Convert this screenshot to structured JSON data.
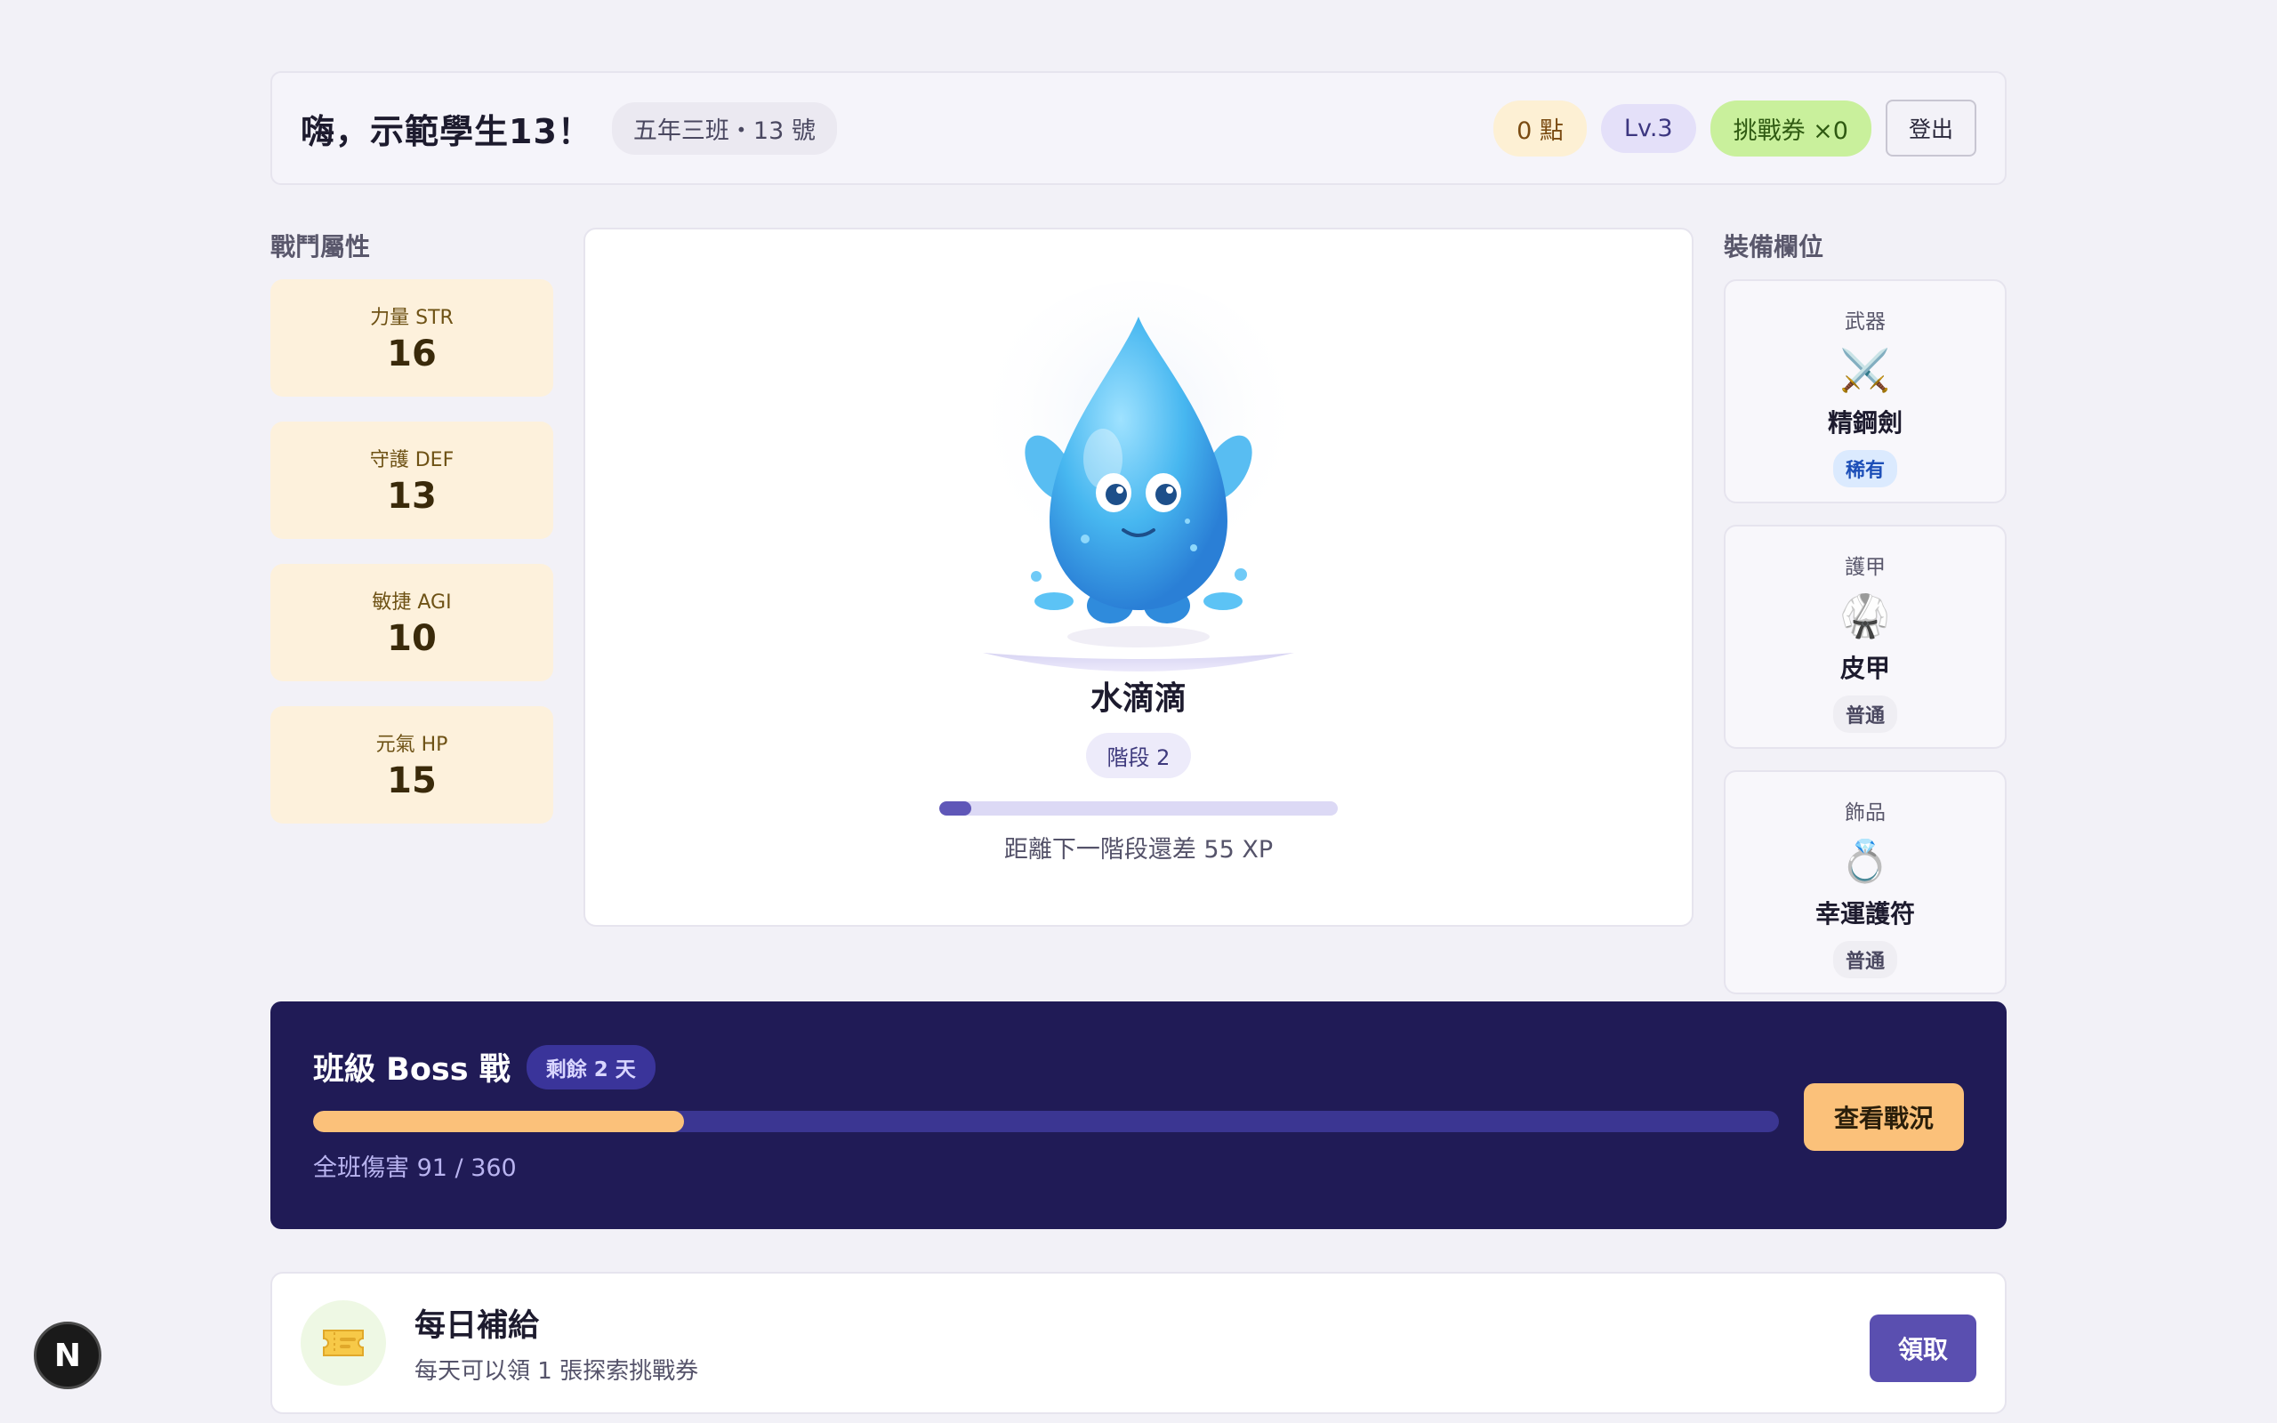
{
  "header": {
    "greeting": "嗨，示範學生13！",
    "class_info": "五年三班・13 號",
    "points": "0 點",
    "level": "Lv.3",
    "tickets": "挑戰券 ×0",
    "logout": "登出"
  },
  "stats": {
    "title": "戰鬥屬性",
    "items": [
      {
        "label": "力量 STR",
        "value": "16"
      },
      {
        "label": "守護 DEF",
        "value": "13"
      },
      {
        "label": "敏捷 AGI",
        "value": "10"
      },
      {
        "label": "元氣 HP",
        "value": "15"
      }
    ]
  },
  "pet": {
    "name": "水滴滴",
    "stage": "階段 2",
    "xp_progress": 0.08,
    "xp_text": "距離下一階段還差 55 XP"
  },
  "equipment": {
    "title": "裝備欄位",
    "slots": [
      {
        "slot": "武器",
        "icon": "crossed-swords-icon",
        "glyph": "⚔️",
        "name": "精鋼劍",
        "rarity": "稀有"
      },
      {
        "slot": "護甲",
        "icon": "martial-arts-uniform-icon",
        "glyph": "🥋",
        "name": "皮甲",
        "rarity": "普通"
      },
      {
        "slot": "飾品",
        "icon": "ring-icon",
        "glyph": "💍",
        "name": "幸運護符",
        "rarity": "普通"
      }
    ]
  },
  "boss": {
    "title": "班級 Boss 戰",
    "days_left": "剩餘 2 天",
    "damage_text": "全班傷害 91 / 360",
    "damage": 91,
    "total": 360,
    "button": "查看戰況"
  },
  "daily": {
    "icon": "ticket-icon",
    "title": "每日補給",
    "subtitle": "每天可以領 1 張探索挑戰券",
    "button": "領取"
  },
  "dev_badge": "N",
  "colors": {
    "accent": "#5a4fb0",
    "boss_bg": "#201b56",
    "boss_fill": "#fbc17a",
    "stat_bg": "#fdf1dc"
  }
}
